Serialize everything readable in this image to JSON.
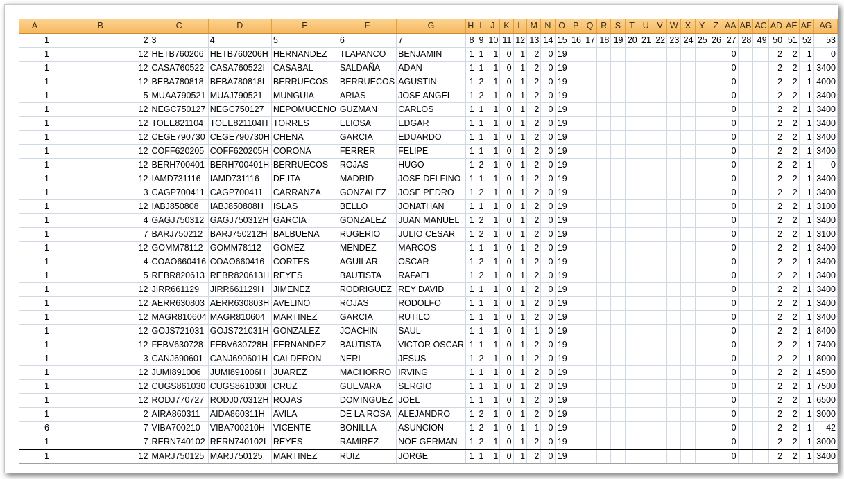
{
  "columns": [
    "A",
    "B",
    "C",
    "D",
    "E",
    "F",
    "G",
    "H",
    "I",
    "J",
    "K",
    "L",
    "M",
    "N",
    "O",
    "P",
    "Q",
    "R",
    "S",
    "T",
    "U",
    "V",
    "W",
    "X",
    "Y",
    "Z",
    "AA",
    "AB",
    "AC",
    "AD",
    "AE",
    "AF",
    "AG"
  ],
  "rows": [
    [
      "1",
      "2",
      "3",
      "4",
      "5",
      "6",
      "7",
      "8",
      "9",
      "10",
      "11",
      "12",
      "13",
      "14",
      "15",
      "16",
      "17",
      "18",
      "19",
      "20",
      "21",
      "22",
      "23",
      "24",
      "25",
      "26",
      "27",
      "28",
      "49",
      "50",
      "51",
      "52",
      "53"
    ],
    [
      "1",
      "12",
      "HETB760206",
      "HETB760206H",
      "HERNANDEZ",
      "TLAPANCO",
      "BENJAMIN",
      "1",
      "1",
      "1",
      "0",
      "1",
      "2",
      "0",
      "19",
      "",
      "",
      "",
      "",
      "",
      "",
      "",
      "",
      "",
      "",
      "",
      "0",
      "",
      "",
      "2",
      "2",
      "1",
      "0"
    ],
    [
      "1",
      "12",
      "CASA760522",
      "CASA760522I",
      "CASABAL",
      "SALDAÑA",
      "ADAN",
      "1",
      "1",
      "1",
      "0",
      "1",
      "2",
      "0",
      "19",
      "",
      "",
      "",
      "",
      "",
      "",
      "",
      "",
      "",
      "",
      "",
      "0",
      "",
      "",
      "2",
      "2",
      "1",
      "3400"
    ],
    [
      "1",
      "12",
      "BEBA780818",
      "BEBA780818I",
      "BERRUECOS",
      "BERRUECOS",
      "AGUSTIN",
      "1",
      "2",
      "1",
      "0",
      "1",
      "2",
      "0",
      "19",
      "",
      "",
      "",
      "",
      "",
      "",
      "",
      "",
      "",
      "",
      "",
      "0",
      "",
      "",
      "2",
      "2",
      "1",
      "4000"
    ],
    [
      "1",
      "5",
      "MUAA790521",
      "MUAJ790521",
      "MUNGUIA",
      "ARIAS",
      "JOSE ANGEL",
      "1",
      "2",
      "1",
      "0",
      "1",
      "2",
      "0",
      "19",
      "",
      "",
      "",
      "",
      "",
      "",
      "",
      "",
      "",
      "",
      "",
      "0",
      "",
      "",
      "2",
      "2",
      "1",
      "3400"
    ],
    [
      "1",
      "12",
      "NEGC750127",
      "NEGC750127",
      "NEPOMUCENO",
      "GUZMAN",
      "CARLOS",
      "1",
      "1",
      "1",
      "0",
      "1",
      "2",
      "0",
      "19",
      "",
      "",
      "",
      "",
      "",
      "",
      "",
      "",
      "",
      "",
      "",
      "0",
      "",
      "",
      "2",
      "2",
      "1",
      "3400"
    ],
    [
      "1",
      "12",
      "TOEE821104",
      "TOEE821104H",
      "TORRES",
      "ELIOSA",
      "EDGAR",
      "1",
      "1",
      "1",
      "0",
      "1",
      "2",
      "0",
      "19",
      "",
      "",
      "",
      "",
      "",
      "",
      "",
      "",
      "",
      "",
      "",
      "0",
      "",
      "",
      "2",
      "2",
      "1",
      "3400"
    ],
    [
      "1",
      "12",
      "CEGE790730",
      "CEGE790730H",
      "CHENA",
      "GARCIA",
      "EDUARDO",
      "1",
      "1",
      "1",
      "0",
      "1",
      "2",
      "0",
      "19",
      "",
      "",
      "",
      "",
      "",
      "",
      "",
      "",
      "",
      "",
      "",
      "0",
      "",
      "",
      "2",
      "2",
      "1",
      "3400"
    ],
    [
      "1",
      "12",
      "COFF620205",
      "COFF620205H",
      "CORONA",
      "FERRER",
      "FELIPE",
      "1",
      "1",
      "1",
      "0",
      "1",
      "2",
      "0",
      "19",
      "",
      "",
      "",
      "",
      "",
      "",
      "",
      "",
      "",
      "",
      "",
      "0",
      "",
      "",
      "2",
      "2",
      "1",
      "3400"
    ],
    [
      "1",
      "12",
      "BERH700401",
      "BERH700401H",
      "BERRUECOS",
      "ROJAS",
      "HUGO",
      "1",
      "2",
      "1",
      "0",
      "1",
      "2",
      "0",
      "19",
      "",
      "",
      "",
      "",
      "",
      "",
      "",
      "",
      "",
      "",
      "",
      "0",
      "",
      "",
      "2",
      "2",
      "1",
      "0"
    ],
    [
      "1",
      "12",
      "IAMD731116",
      "IAMD731116",
      "DE ITA",
      "MADRID",
      "JOSE DELFINO",
      "1",
      "1",
      "1",
      "0",
      "1",
      "2",
      "0",
      "19",
      "",
      "",
      "",
      "",
      "",
      "",
      "",
      "",
      "",
      "",
      "",
      "0",
      "",
      "",
      "2",
      "2",
      "1",
      "3400"
    ],
    [
      "1",
      "3",
      "CAGP700411",
      "CAGP700411",
      "CARRANZA",
      "GONZALEZ",
      "JOSE PEDRO",
      "1",
      "2",
      "1",
      "0",
      "1",
      "2",
      "0",
      "19",
      "",
      "",
      "",
      "",
      "",
      "",
      "",
      "",
      "",
      "",
      "",
      "0",
      "",
      "",
      "2",
      "2",
      "1",
      "3400"
    ],
    [
      "1",
      "12",
      "IABJ850808",
      "IABJ850808H",
      "ISLAS",
      "BELLO",
      "JONATHAN",
      "1",
      "1",
      "1",
      "0",
      "1",
      "2",
      "0",
      "19",
      "",
      "",
      "",
      "",
      "",
      "",
      "",
      "",
      "",
      "",
      "",
      "0",
      "",
      "",
      "2",
      "2",
      "1",
      "3100"
    ],
    [
      "1",
      "4",
      "GAGJ750312",
      "GAGJ750312H",
      "GARCIA",
      "GONZALEZ",
      "JUAN MANUEL",
      "1",
      "2",
      "1",
      "0",
      "1",
      "2",
      "0",
      "19",
      "",
      "",
      "",
      "",
      "",
      "",
      "",
      "",
      "",
      "",
      "",
      "0",
      "",
      "",
      "2",
      "2",
      "1",
      "3400"
    ],
    [
      "1",
      "7",
      "BARJ750212",
      "BARJ750212H",
      "BALBUENA",
      "RUGERIO",
      "JULIO CESAR",
      "1",
      "2",
      "1",
      "0",
      "1",
      "2",
      "0",
      "19",
      "",
      "",
      "",
      "",
      "",
      "",
      "",
      "",
      "",
      "",
      "",
      "0",
      "",
      "",
      "2",
      "2",
      "1",
      "3100"
    ],
    [
      "1",
      "12",
      "GOMM78112",
      "GOMM78112",
      "GOMEZ",
      "MENDEZ",
      "MARCOS",
      "1",
      "1",
      "1",
      "0",
      "1",
      "2",
      "0",
      "19",
      "",
      "",
      "",
      "",
      "",
      "",
      "",
      "",
      "",
      "",
      "",
      "0",
      "",
      "",
      "2",
      "2",
      "1",
      "3400"
    ],
    [
      "1",
      "4",
      "COAO660416",
      "COAO660416",
      "CORTES",
      "AGUILAR",
      "OSCAR",
      "1",
      "2",
      "1",
      "0",
      "1",
      "2",
      "0",
      "19",
      "",
      "",
      "",
      "",
      "",
      "",
      "",
      "",
      "",
      "",
      "",
      "0",
      "",
      "",
      "2",
      "2",
      "1",
      "3400"
    ],
    [
      "1",
      "5",
      "REBR820613",
      "REBR820613H",
      "REYES",
      "BAUTISTA",
      "RAFAEL",
      "1",
      "2",
      "1",
      "0",
      "1",
      "2",
      "0",
      "19",
      "",
      "",
      "",
      "",
      "",
      "",
      "",
      "",
      "",
      "",
      "",
      "0",
      "",
      "",
      "2",
      "2",
      "1",
      "3400"
    ],
    [
      "1",
      "12",
      "JIRR661129",
      "JIRR661129H",
      "JIMENEZ",
      "RODRIGUEZ",
      "REY DAVID",
      "1",
      "1",
      "1",
      "0",
      "1",
      "2",
      "0",
      "19",
      "",
      "",
      "",
      "",
      "",
      "",
      "",
      "",
      "",
      "",
      "",
      "0",
      "",
      "",
      "2",
      "2",
      "1",
      "3400"
    ],
    [
      "1",
      "12",
      "AERR630803",
      "AERR630803H",
      "AVELINO",
      "ROJAS",
      "RODOLFO",
      "1",
      "1",
      "1",
      "0",
      "1",
      "2",
      "0",
      "19",
      "",
      "",
      "",
      "",
      "",
      "",
      "",
      "",
      "",
      "",
      "",
      "0",
      "",
      "",
      "2",
      "2",
      "1",
      "3400"
    ],
    [
      "1",
      "12",
      "MAGR810604",
      "MAGR810604",
      "MARTINEZ",
      "GARCIA",
      "RUTILO",
      "1",
      "1",
      "1",
      "0",
      "1",
      "2",
      "0",
      "19",
      "",
      "",
      "",
      "",
      "",
      "",
      "",
      "",
      "",
      "",
      "",
      "0",
      "",
      "",
      "2",
      "2",
      "1",
      "3400"
    ],
    [
      "1",
      "12",
      "GOJS721031",
      "GOJS721031H",
      "GONZALEZ",
      "JOACHIN",
      "SAUL",
      "1",
      "1",
      "1",
      "0",
      "1",
      "1",
      "0",
      "19",
      "",
      "",
      "",
      "",
      "",
      "",
      "",
      "",
      "",
      "",
      "",
      "0",
      "",
      "",
      "2",
      "2",
      "1",
      "8400"
    ],
    [
      "1",
      "12",
      "FEBV630728",
      "FEBV630728H",
      "FERNANDEZ",
      "BAUTISTA",
      "VICTOR OSCAR",
      "1",
      "1",
      "1",
      "0",
      "1",
      "2",
      "0",
      "19",
      "",
      "",
      "",
      "",
      "",
      "",
      "",
      "",
      "",
      "",
      "",
      "0",
      "",
      "",
      "2",
      "2",
      "1",
      "7400"
    ],
    [
      "1",
      "3",
      "CANJ690601",
      "CANJ690601H",
      "CALDERON",
      "NERI",
      "JESUS",
      "1",
      "2",
      "1",
      "0",
      "1",
      "2",
      "0",
      "19",
      "",
      "",
      "",
      "",
      "",
      "",
      "",
      "",
      "",
      "",
      "",
      "0",
      "",
      "",
      "2",
      "2",
      "1",
      "8000"
    ],
    [
      "1",
      "12",
      "JUMI891006",
      "JUMI891006H",
      "JUAREZ",
      "MACHORRO",
      "IRVING",
      "1",
      "1",
      "1",
      "0",
      "1",
      "2",
      "0",
      "19",
      "",
      "",
      "",
      "",
      "",
      "",
      "",
      "",
      "",
      "",
      "",
      "0",
      "",
      "",
      "2",
      "2",
      "1",
      "4500"
    ],
    [
      "1",
      "12",
      "CUGS861030",
      "CUGS861030I",
      "CRUZ",
      "GUEVARA",
      "SERGIO",
      "1",
      "1",
      "1",
      "0",
      "1",
      "2",
      "0",
      "19",
      "",
      "",
      "",
      "",
      "",
      "",
      "",
      "",
      "",
      "",
      "",
      "0",
      "",
      "",
      "2",
      "2",
      "1",
      "7500"
    ],
    [
      "1",
      "12",
      "RODJ770727",
      "RODJ070312H",
      "ROJAS",
      "DOMINGUEZ",
      "JOEL",
      "1",
      "1",
      "1",
      "0",
      "1",
      "2",
      "0",
      "19",
      "",
      "",
      "",
      "",
      "",
      "",
      "",
      "",
      "",
      "",
      "",
      "0",
      "",
      "",
      "2",
      "2",
      "1",
      "6500"
    ],
    [
      "1",
      "2",
      "AIRA860311",
      "AIDA860311H",
      "AVILA",
      "DE LA ROSA",
      "ALEJANDRO",
      "1",
      "2",
      "1",
      "0",
      "1",
      "2",
      "0",
      "19",
      "",
      "",
      "",
      "",
      "",
      "",
      "",
      "",
      "",
      "",
      "",
      "0",
      "",
      "",
      "2",
      "2",
      "1",
      "3000"
    ],
    [
      "6",
      "7",
      "VIBA700210",
      "VIBA700210H",
      "VICENTE",
      "BONILLA",
      "ASUNCION",
      "1",
      "2",
      "1",
      "0",
      "1",
      "1",
      "0",
      "19",
      "",
      "",
      "",
      "",
      "",
      "",
      "",
      "",
      "",
      "",
      "",
      "0",
      "",
      "",
      "2",
      "2",
      "1",
      "42"
    ],
    [
      "1",
      "7",
      "RERN740102",
      "RERN740102I",
      "REYES",
      "RAMIREZ",
      "NOE GERMAN",
      "1",
      "2",
      "1",
      "0",
      "1",
      "2",
      "0",
      "19",
      "",
      "",
      "",
      "",
      "",
      "",
      "",
      "",
      "",
      "",
      "",
      "0",
      "",
      "",
      "2",
      "2",
      "1",
      "3000"
    ],
    [
      "1",
      "12",
      "MARJ750125",
      "MARJ750125",
      "MARTINEZ",
      "RUIZ",
      "JORGE",
      "1",
      "1",
      "1",
      "0",
      "1",
      "2",
      "0",
      "19",
      "",
      "",
      "",
      "",
      "",
      "",
      "",
      "",
      "",
      "",
      "",
      "0",
      "",
      "",
      "2",
      "2",
      "1",
      "3400"
    ]
  ]
}
